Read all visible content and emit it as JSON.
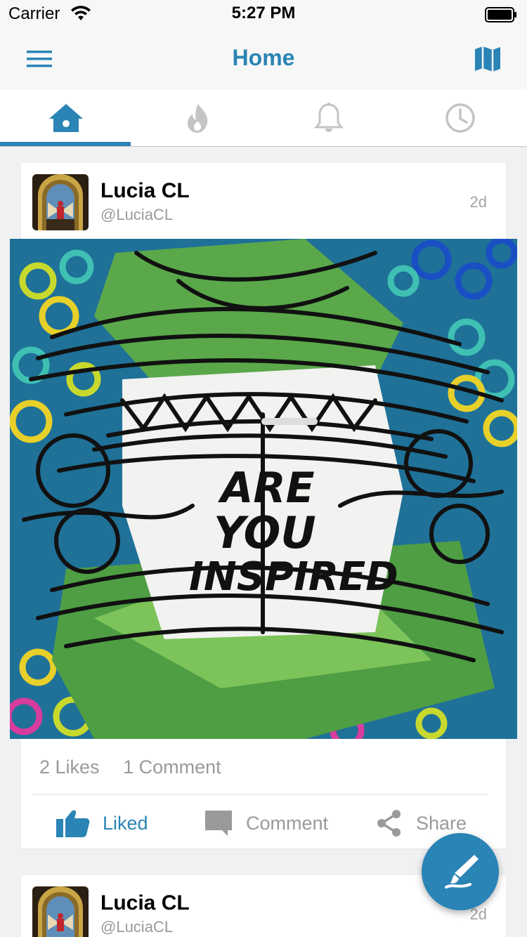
{
  "status_bar": {
    "carrier": "Carrier",
    "time": "5:27 PM"
  },
  "nav": {
    "title": "Home"
  },
  "tabs": [
    {
      "name": "home",
      "icon": "home-icon",
      "active": true
    },
    {
      "name": "trending",
      "icon": "flame-icon",
      "active": false
    },
    {
      "name": "notifications",
      "icon": "bell-icon",
      "active": false
    },
    {
      "name": "history",
      "icon": "clock-icon",
      "active": false
    }
  ],
  "posts": [
    {
      "author": "Lucia CL",
      "handle": "@LuciaCL",
      "time": "2d",
      "image_text": [
        "ARE",
        "YOU",
        "INSPIRED"
      ],
      "likes": "2 Likes",
      "comments": "1 Comment",
      "actions": {
        "like": "Liked",
        "comment": "Comment",
        "share": "Share"
      }
    },
    {
      "author": "Lucia CL",
      "handle": "@LuciaCL",
      "time": "2d"
    }
  ],
  "colors": {
    "accent": "#2a84b5",
    "muted": "#9a9a9a",
    "background": "#f0f1f3"
  }
}
